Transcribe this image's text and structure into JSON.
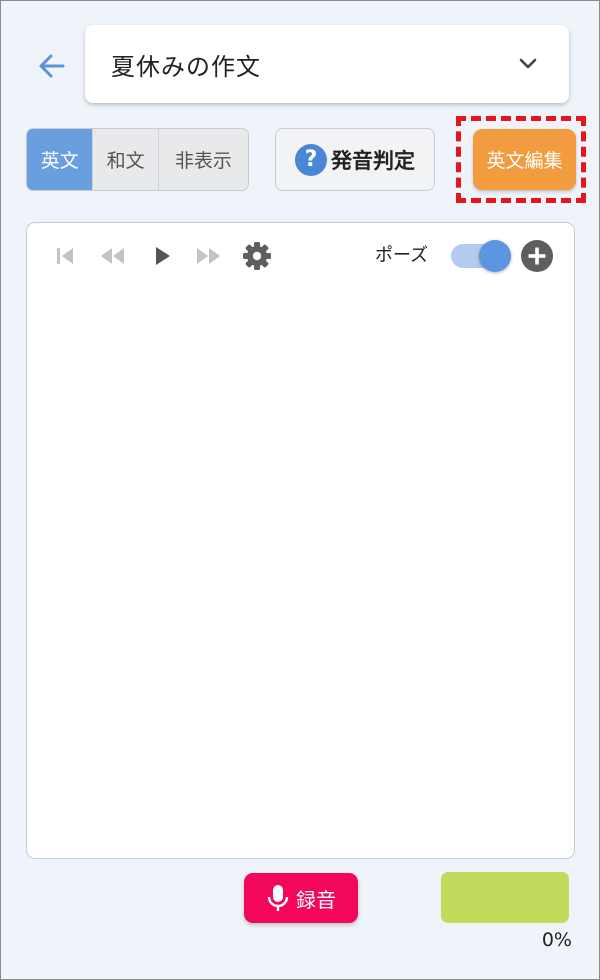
{
  "header": {
    "title": "夏休みの作文",
    "back_icon": "arrow-left-icon",
    "dropdown_icon": "chevron-down-icon"
  },
  "display_mode": {
    "options": [
      "英文",
      "和文",
      "非表示"
    ],
    "selected": "英文"
  },
  "pronunciation_button": {
    "label": "発音判定",
    "icon": "question-circle-icon"
  },
  "edit_english_button": {
    "label": "英文編集"
  },
  "player": {
    "controls": [
      "skip-previous-icon",
      "rewind-icon",
      "play-icon",
      "fast-forward-icon",
      "gear-icon"
    ],
    "pause_label": "ポーズ",
    "pause_toggle_on": true,
    "add_icon": "plus-circle-icon"
  },
  "record_button": {
    "label": "録音",
    "icon": "microphone-icon"
  },
  "progress": {
    "value": 0,
    "display": "0%"
  },
  "colors": {
    "accent_blue": "#6a9fdf",
    "edit_orange": "#f39c3f",
    "record_pink": "#f2075a",
    "progress_green": "#c2db5c",
    "highlight_red": "#e8141c"
  }
}
